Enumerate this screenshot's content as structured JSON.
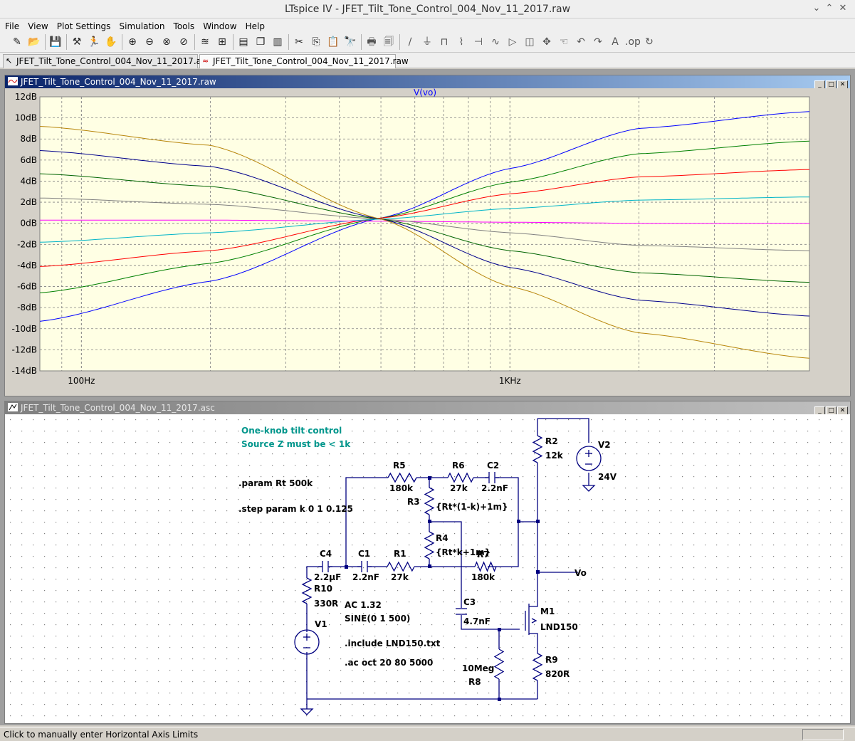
{
  "window": {
    "title": "LTspice IV - JFET_Tilt_Tone_Control_004_Nov_11_2017.raw"
  },
  "menu": [
    "File",
    "View",
    "Plot Settings",
    "Simulation",
    "Tools",
    "Window",
    "Help"
  ],
  "toolbar": {
    "icons": [
      "new-schematic-icon",
      "open-icon",
      "save-icon",
      "control-panel-icon",
      "run-icon",
      "halt-icon",
      "zoom-in-icon",
      "zoom-out-icon",
      "zoom-fit-icon",
      "zoom-cancel-icon",
      "autorange-icon",
      "plot-axes-icon",
      "tile-horizontal-icon",
      "cascade-icon",
      "tile-vertical-icon",
      "cut-icon",
      "copy-icon",
      "paste-icon",
      "find-icon",
      "print-icon",
      "print-preview-icon",
      "wire-icon",
      "ground-icon",
      "label-icon",
      "resistor-icon",
      "capacitor-icon",
      "inductor-icon",
      "diode-icon",
      "component-icon",
      "move-icon",
      "drag-icon",
      "undo-icon",
      "redo-icon",
      "text-icon",
      "spice-directive-icon",
      "rotate-icon"
    ]
  },
  "tabs": [
    {
      "label": "JFET_Tilt_Tone_Control_004_Nov_11_2017.asc",
      "active": false
    },
    {
      "label": "JFET_Tilt_Tone_Control_004_Nov_11_2017.raw",
      "active": true
    }
  ],
  "plot_window": {
    "title": "JFET_Tilt_Tone_Control_004_Nov_11_2017.raw",
    "trace_label": "V(vo)",
    "trace_label_color": "#0000ff"
  },
  "schematic_window": {
    "title": "JFET_Tilt_Tone_Control_004_Nov_11_2017.asc"
  },
  "schematic": {
    "comment1": "One-knob tilt control",
    "comment2": "Source Z must be < 1k",
    "param": ".param Rt 500k",
    "step": ".step param k 0 1 0.125",
    "ac_src": "AC 1.32",
    "sine_src": "SINE(0 1 500)",
    "include": ".include LND150.txt",
    "ac_cmd": ".ac oct 20 80 5000",
    "components": [
      {
        "ref": "R5",
        "value": "180k"
      },
      {
        "ref": "R6",
        "value": "27k"
      },
      {
        "ref": "C2",
        "value": "2.2nF"
      },
      {
        "ref": "R3",
        "value": "{Rt*(1-k)+1m}"
      },
      {
        "ref": "R4",
        "value": "{Rt*k+1m}"
      },
      {
        "ref": "R7",
        "value": "180k"
      },
      {
        "ref": "C4",
        "value": "2.2µF"
      },
      {
        "ref": "C1",
        "value": "2.2nF"
      },
      {
        "ref": "R1",
        "value": "27k"
      },
      {
        "ref": "R10",
        "value": "330R"
      },
      {
        "ref": "V1",
        "value": ""
      },
      {
        "ref": "C3",
        "value": "4.7nF"
      },
      {
        "ref": "M1",
        "value": "LND150"
      },
      {
        "ref": "R8",
        "value": "10Meg"
      },
      {
        "ref": "R9",
        "value": "820R"
      },
      {
        "ref": "R2",
        "value": "12k"
      },
      {
        "ref": "V2",
        "value": "24V"
      }
    ],
    "net_label": "Vo"
  },
  "status": {
    "text": "Click to manually enter Horizontal Axis Limits"
  },
  "chart_data": {
    "type": "line",
    "title": "V(vo)",
    "xlabel": "",
    "ylabel": "",
    "x_scale": "log",
    "xlim": [
      80,
      5000
    ],
    "ylim": [
      -14,
      12
    ],
    "y_ticks": [
      "12dB",
      "10dB",
      "8dB",
      "6dB",
      "4dB",
      "2dB",
      "0dB",
      "-2dB",
      "-4dB",
      "-6dB",
      "-8dB",
      "-10dB",
      "-12dB",
      "-14dB"
    ],
    "x_ticks": [
      "100Hz",
      "1KHz"
    ],
    "grid": true,
    "x": [
      80,
      200,
      500,
      1000,
      2000,
      5000
    ],
    "series": [
      {
        "color": "#0000ff",
        "values": [
          -9.3,
          -5.5,
          0.5,
          5.2,
          9.0,
          10.6
        ]
      },
      {
        "color": "#008000",
        "values": [
          -6.6,
          -3.8,
          0.5,
          3.9,
          6.6,
          7.8
        ]
      },
      {
        "color": "#ff0000",
        "values": [
          -4.1,
          -2.6,
          0.5,
          2.8,
          4.4,
          5.1
        ]
      },
      {
        "color": "#00b4c8",
        "values": [
          -1.8,
          -0.9,
          0.4,
          1.4,
          2.2,
          2.5
        ]
      },
      {
        "color": "#ff00ff",
        "values": [
          0.3,
          0.3,
          0.2,
          0.1,
          0.0,
          0.0
        ]
      },
      {
        "color": "#808080",
        "values": [
          2.4,
          1.8,
          0.4,
          -0.9,
          -2.1,
          -2.6
        ]
      },
      {
        "color": "#006400",
        "values": [
          4.7,
          3.5,
          0.4,
          -2.6,
          -4.7,
          -5.6
        ]
      },
      {
        "color": "#00008b",
        "values": [
          6.9,
          5.4,
          0.4,
          -4.2,
          -7.3,
          -8.8
        ]
      },
      {
        "color": "#b8860b",
        "values": [
          9.2,
          7.4,
          0.4,
          -6.0,
          -10.4,
          -12.8
        ]
      }
    ]
  }
}
